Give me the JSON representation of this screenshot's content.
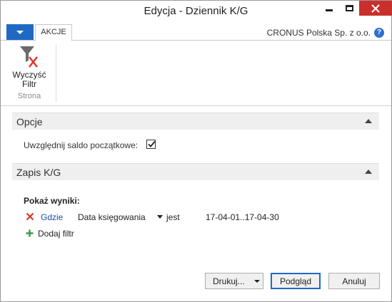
{
  "window": {
    "title": "Edycja - Dziennik K/G",
    "controls": {
      "minimize": "minimize-icon",
      "maximize": "maximize-icon",
      "close": "close-icon"
    }
  },
  "ribbon": {
    "tab_label": "AKCJE",
    "company": "CRONUS Polska Sp. z o.o.",
    "help_glyph": "?",
    "actions": [
      {
        "label_line1": "Wyczyść",
        "label_line2": "Filtr",
        "icon": "clear-filter-icon"
      }
    ],
    "group_label": "Strona"
  },
  "sections": {
    "options": {
      "title": "Opcje",
      "include_opening_balance_label": "Uwzględnij saldo początkowe:",
      "include_opening_balance_checked": true
    },
    "gl_entry": {
      "title": "Zapis K/G",
      "show_results_label": "Pokaż wyniki:",
      "filter": {
        "where_label": "Gdzie",
        "field": "Data księgowania",
        "operator": "jest",
        "value": "17-04-01..17-04-30"
      },
      "add_filter_label": "Dodaj filtr"
    }
  },
  "buttons": {
    "print": "Drukuj...",
    "preview": "Podgląd",
    "cancel": "Anuluj"
  },
  "colors": {
    "accent": "#1f69c5",
    "close_button": "#c9302c",
    "remove_icon": "#d9362b",
    "add_icon": "#3a9a4a",
    "link": "#1a4fa0"
  }
}
